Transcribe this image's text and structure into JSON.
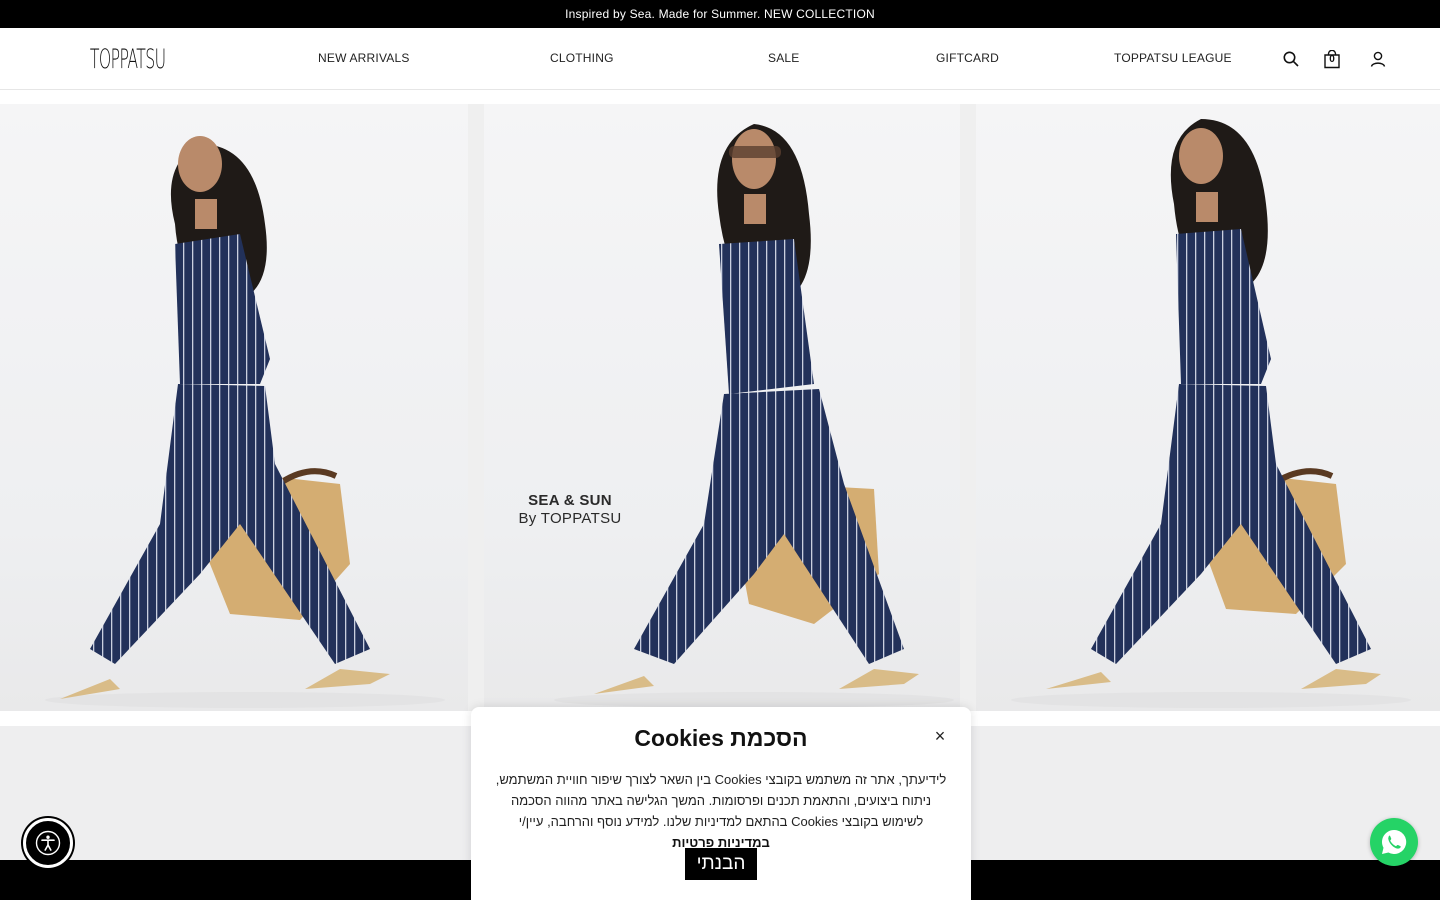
{
  "announcement": "Inspired by Sea. Made for Summer. NEW COLLECTION",
  "header": {
    "logo": "TOPPATSU",
    "nav": [
      {
        "label": "NEW ARRIVALS"
      },
      {
        "label": "CLOTHING"
      },
      {
        "label": "SALE"
      },
      {
        "label": "GIFTCARD"
      },
      {
        "label": "TOPPATSU LEAGUE"
      }
    ],
    "icons": {
      "search": "search-icon",
      "bag": "shopping-bag-icon",
      "account": "user-icon"
    },
    "cart_count": "0"
  },
  "hero": {
    "overlay_line1": "SEA & SUN",
    "overlay_line2": "By TOPPATSU",
    "colors": {
      "denim": "#22315a",
      "stripe": "#d6dae6",
      "bag": "#d4ad72",
      "skin": "#b98a6a",
      "hair": "#1f1a17",
      "shoe": "#d9bc88"
    }
  },
  "cookie": {
    "title": "הסכמת Cookies",
    "body_text": "לידיעתך, אתר זה משתמש בקובצי Cookies בין השאר לצורך שיפור חוויית המשתמש, ניתוח ביצועים, והתאמת תכנים ופרסומות. המשך הגלישה באתר מהווה הסכמה לשימוש בקובצי Cookies בהתאם למדיניות שלנו. למידע נוסף והרחבה, עיין/י",
    "link_text": "במדיניות פרטיות",
    "accept_label": "הבנתי",
    "close_symbol": "×"
  },
  "floating": {
    "accessibility": "accessibility-icon",
    "whatsapp": "whatsapp-icon"
  }
}
